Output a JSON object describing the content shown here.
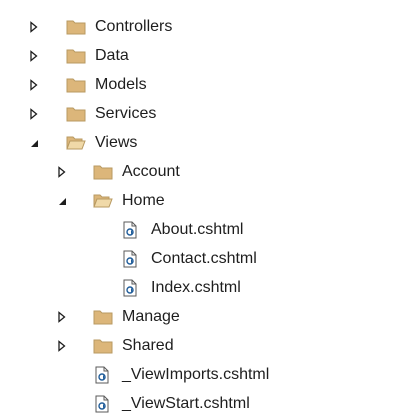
{
  "solution_explorer": {
    "tree": [
      {
        "label": "Controllers",
        "type": "folder",
        "expanded": false,
        "depth": 0
      },
      {
        "label": "Data",
        "type": "folder",
        "expanded": false,
        "depth": 0
      },
      {
        "label": "Models",
        "type": "folder",
        "expanded": false,
        "depth": 0
      },
      {
        "label": "Services",
        "type": "folder",
        "expanded": false,
        "depth": 0
      },
      {
        "label": "Views",
        "type": "folder",
        "expanded": true,
        "depth": 0
      },
      {
        "label": "Account",
        "type": "folder",
        "expanded": false,
        "depth": 1
      },
      {
        "label": "Home",
        "type": "folder",
        "expanded": true,
        "depth": 1
      },
      {
        "label": "About.cshtml",
        "type": "file",
        "depth": 2
      },
      {
        "label": "Contact.cshtml",
        "type": "file",
        "depth": 2
      },
      {
        "label": "Index.cshtml",
        "type": "file",
        "depth": 2
      },
      {
        "label": "Manage",
        "type": "folder",
        "expanded": false,
        "depth": 1
      },
      {
        "label": "Shared",
        "type": "folder",
        "expanded": false,
        "depth": 1
      },
      {
        "label": "_ViewImports.cshtml",
        "type": "file",
        "depth": 1
      },
      {
        "label": "_ViewStart.cshtml",
        "type": "file",
        "depth": 1
      }
    ]
  },
  "colors": {
    "folder_fill": "#dcb67a",
    "folder_outline": "#b89a62",
    "twisty": "#1e1e1e",
    "file_badge": "#1f5c99",
    "text": "#1e1e1e"
  },
  "icons": {
    "collapsed": "chevron-right-icon",
    "expanded": "chevron-down-icon",
    "folder_closed": "folder-icon",
    "folder_open": "folder-open-icon",
    "razor_file": "razor-file-icon"
  }
}
